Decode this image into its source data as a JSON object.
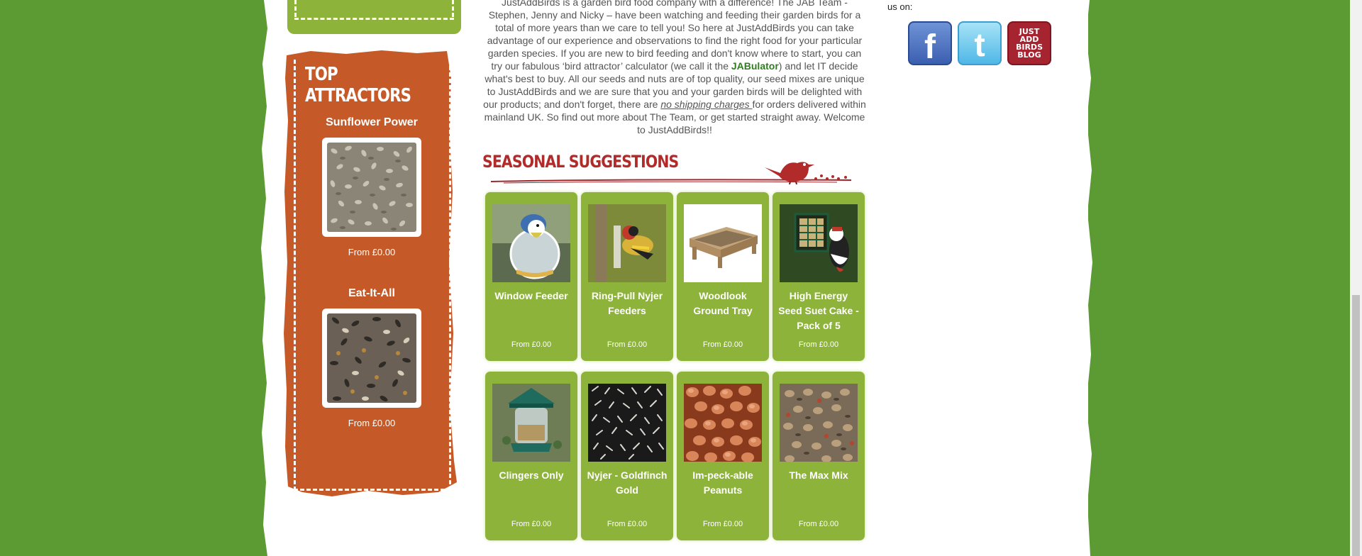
{
  "intro": {
    "line1": "JustAddBirds is a garden bird food company with a difference! The JAB Team -",
    "line2": "Stephen, Jenny and Nicky – have been watching and feeding their garden birds for a",
    "line3": "total of more years than we care to tell you! So here at JustAddBirds you can take",
    "line4": "advantage of our experience and observations to find the right food for your particular",
    "line5": "garden species. If you are new to bird feeding and don't know where to start, you can",
    "line6a": "try our fabulous ‘bird attractor’ calculator (we call it the ",
    "jab_link": "JABulator",
    "line6b": ") and let IT decide",
    "line7": "what's best to buy. All our seeds and nuts are of top quality, our seed mixes are unique",
    "line8": "to JustAddBirds and we are sure that you and your garden birds will be delighted with",
    "line9a": "our products; and don't forget, there are ",
    "shipping_link": "no shipping charges ",
    "line9b": "for orders delivered within",
    "line10": "mainland UK. So find out more about The Team, or get started straight away. Welcome",
    "line11": "to JustAddBirds!!"
  },
  "sidebar": {
    "title": "Top Attractors",
    "items": [
      {
        "name": "Sunflower Power",
        "price": "From £0.00"
      },
      {
        "name": "Eat-It-All",
        "price": "From £0.00"
      }
    ]
  },
  "seasonal": {
    "title": "Seasonal Suggestions",
    "products": [
      {
        "name": "Window Feeder",
        "price": "From £0.00"
      },
      {
        "name": "Ring-Pull Nyjer Feeders",
        "price": "From £0.00"
      },
      {
        "name": "Woodlook Ground Tray",
        "price": "From £0.00"
      },
      {
        "name": "High Energy Seed Suet Cake - Pack of 5",
        "price": "From £0.00"
      },
      {
        "name": "Clingers Only",
        "price": "From £0.00"
      },
      {
        "name": "Nyjer - Goldfinch Gold",
        "price": "From £0.00"
      },
      {
        "name": "Im-peck-able Peanuts",
        "price": "From £0.00"
      },
      {
        "name": "The Max Mix",
        "price": "From £0.00"
      }
    ]
  },
  "follow": {
    "text": "us on:",
    "facebook_icon": "facebook-icon",
    "twitter_icon": "twitter-icon",
    "blog_icon": "blog-icon",
    "blog_label": "JUST\nADD\nBIRDS\nBLOG"
  },
  "colors": {
    "background_green": "#5c9a33",
    "product_green": "#8db33a",
    "sidebar_orange": "#c55a28",
    "heading_red": "#b22b2b",
    "link_green": "#2f7d1f"
  }
}
